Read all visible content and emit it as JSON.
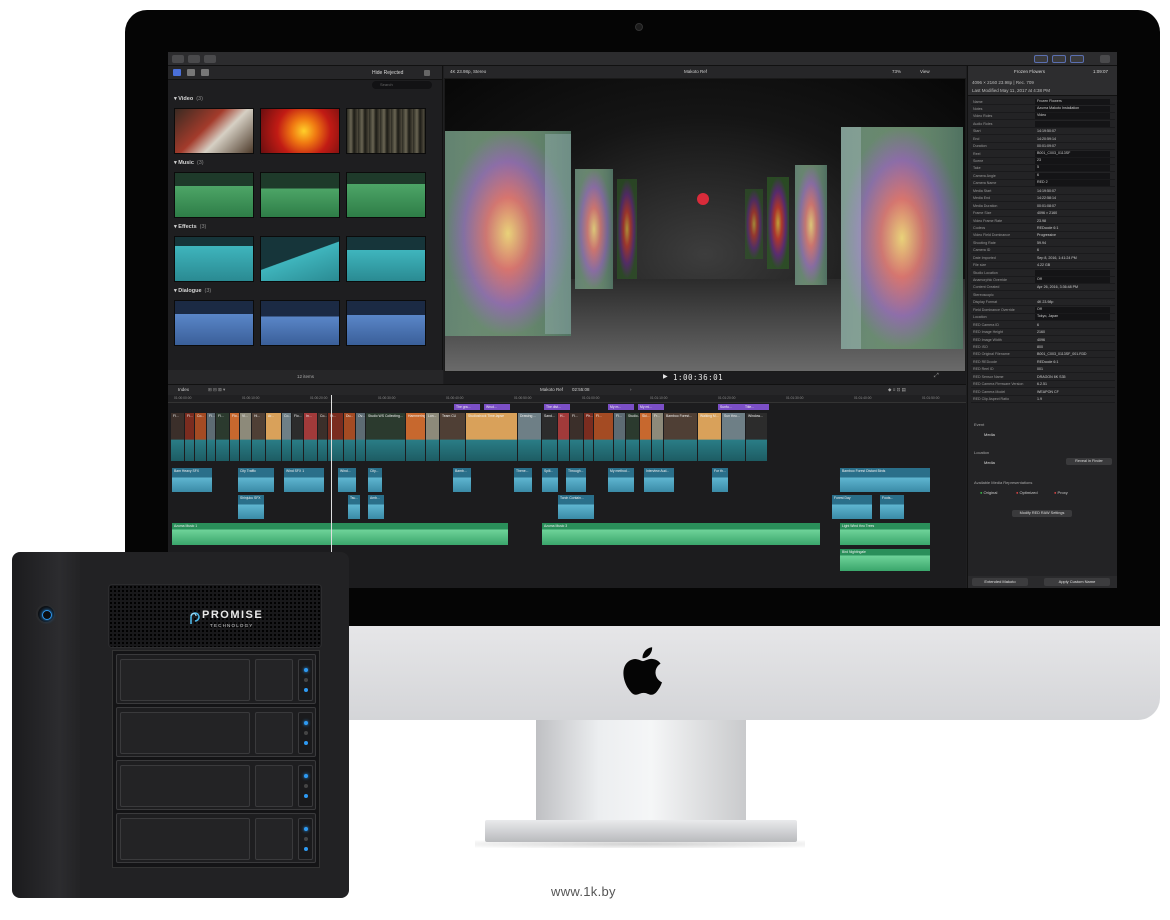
{
  "watermark": "www.1k.by",
  "fcp": {
    "browser": {
      "filter_label": "Hide Rejected",
      "search_placeholder": "Search",
      "categories": [
        {
          "name": "Video",
          "count": "(3)"
        },
        {
          "name": "Music",
          "count": "(3)"
        },
        {
          "name": "Effects",
          "count": "(3)"
        },
        {
          "name": "Dialogue",
          "count": "(3)"
        }
      ],
      "footer": "12 items"
    },
    "viewer": {
      "format": "4K 23.98p, Stereo",
      "title": "Makoto Ref",
      "zoom": "73%",
      "view_menu": "View",
      "timecode": "1:00:36:01"
    },
    "inspector": {
      "clip_name": "Frozen Flowers",
      "duration": "1:09:07",
      "format_line": "4096 × 2160 23.98p | Rec. 709",
      "modified_line": "Last Modified May 11, 2017 at 4:38 PM",
      "rows": [
        {
          "k": "Name",
          "v": "Frozen Flowers"
        },
        {
          "k": "Notes",
          "v": "Azuma Makoto Installation"
        },
        {
          "k": "Video Roles",
          "v": "Video"
        },
        {
          "k": "Audio Roles",
          "v": ""
        },
        {
          "k": "Start",
          "v": "14:19:50:07"
        },
        {
          "k": "End",
          "v": "14:20:59:14"
        },
        {
          "k": "Duration",
          "v": "00:01:09:07"
        },
        {
          "k": "Reel",
          "v": "B001_C003_0113SF"
        },
        {
          "k": "Scene",
          "v": "23"
        },
        {
          "k": "Take",
          "v": "5"
        },
        {
          "k": "Camera Angle",
          "v": "6"
        },
        {
          "k": "Camera Name",
          "v": "RED 2"
        },
        {
          "k": "Media Start",
          "v": "14:19:50:07"
        },
        {
          "k": "Media End",
          "v": "14:22:58:14"
        },
        {
          "k": "Media Duration",
          "v": "00:01:08:07"
        },
        {
          "k": "Frame Size",
          "v": "4096 × 2160"
        },
        {
          "k": "Video Frame Rate",
          "v": "23.98"
        },
        {
          "k": "Codecs",
          "v": "REDcode 6:1"
        },
        {
          "k": "Video Field Dominance",
          "v": "Progressive"
        },
        {
          "k": "Shooting Rate",
          "v": "59.94"
        },
        {
          "k": "Camera ID",
          "v": "6"
        },
        {
          "k": "Date Imported",
          "v": "Sep 8, 2016, 1:41:24 PM"
        },
        {
          "k": "File size",
          "v": "4.22 GB"
        },
        {
          "k": "Studio Location",
          "v": ""
        },
        {
          "k": "Anamorphic Override",
          "v": "Off"
        },
        {
          "k": "Content Created",
          "v": "Apr 26, 2016, 3:36:48 PM"
        },
        {
          "k": "Stereoscopic",
          "v": ""
        },
        {
          "k": "Display Format",
          "v": "4K 23.98p"
        },
        {
          "k": "Field Dominance Override",
          "v": "Off"
        },
        {
          "k": "Location",
          "v": "Tokyo, Japan"
        },
        {
          "k": "RED Camera ID",
          "v": "6"
        },
        {
          "k": "RED Image Height",
          "v": "2160"
        },
        {
          "k": "RED Image Width",
          "v": "4096"
        },
        {
          "k": "RED ISO",
          "v": "800"
        },
        {
          "k": "RED Original Filename",
          "v": "B001_C003_0113SF_001.R3D"
        },
        {
          "k": "RED REDcode",
          "v": "REDcode 6:1"
        },
        {
          "k": "RED Reel ID",
          "v": "001"
        },
        {
          "k": "RED Sensor Name",
          "v": "DRAGON 6K S35"
        },
        {
          "k": "RED Camera Firmware Version",
          "v": "6.2.51"
        },
        {
          "k": "RED Camera Model",
          "v": "WEAPON CF"
        },
        {
          "k": "RED Clip Aspect Ratio",
          "v": "1.9"
        }
      ],
      "event_label": "Event",
      "event_value": "Media",
      "location_label": "Location",
      "location_value": "Media",
      "reveal_button": "Reveal in Finder",
      "representations_label": "Available Media Representations",
      "representations": [
        "Original",
        "Optimized",
        "Proxy"
      ],
      "modify_button": "Modify RED RAW Settings",
      "metadata_view": "Extended Makoto",
      "apply_button": "Apply Custom Name"
    },
    "timeline": {
      "index_label": "Index",
      "project_name": "Makoto Ref",
      "project_duration": "02:55:08",
      "ruler": [
        "01:00:00:00",
        "01:00:10:00",
        "01:00:20:00",
        "01:00:30:00",
        "01:00:40:00",
        "01:00:50:00",
        "01:01:00:00",
        "01:01:10:00",
        "01:01:20:00",
        "01:01:30:00",
        "01:01:40:00",
        "01:01:50:00"
      ],
      "titles": [
        "The gra...",
        "Wrud...",
        "The dist...",
        "My m...",
        "My mi...",
        "Sunfu...",
        "Title..."
      ],
      "video_labels": [
        "Fl...",
        "Fl...",
        "Co...",
        "Fl...",
        "Fl...",
        "Flo...",
        "Vi...",
        "Hi...",
        "Ar...",
        "Co...",
        "Flo...",
        "In...",
        "Co...",
        "St...",
        "Du...",
        "Ov...",
        "Studio WS Collecting...",
        "Hammering...",
        "Lon...",
        "Team CU",
        "Studioshock Time-lapse",
        "Drawing ...",
        "Sand...",
        "H...",
        "Fl...",
        "Ph...",
        "Fl...",
        "Fl...",
        "Studio...",
        "Ski...",
        "Fr...",
        "Bamboo Forest...",
        "Walking M...",
        "Sun thru...",
        "Window..."
      ],
      "audio_clips": [
        "Bam Heavy SFX",
        "City Traffic",
        "Wind SFX 1",
        "Wind...",
        "City...",
        "Bamb...",
        "Thene...",
        "Spill...",
        "Through...",
        "My method...",
        "Interview Aud...",
        "For th...",
        "Bamboo Forest Distant Birds",
        "Shinjuku SFX",
        "Tsu...",
        "Amb...",
        "Torch Contain...",
        "Forest Day",
        "Foots...",
        "Azuma Music 1",
        "Azuma Music 3",
        "Light Wind thru Trees",
        "Bird Nightingale"
      ]
    }
  },
  "promise": {
    "brand": "PROMISE",
    "sub": "TECHNOLOGY"
  }
}
